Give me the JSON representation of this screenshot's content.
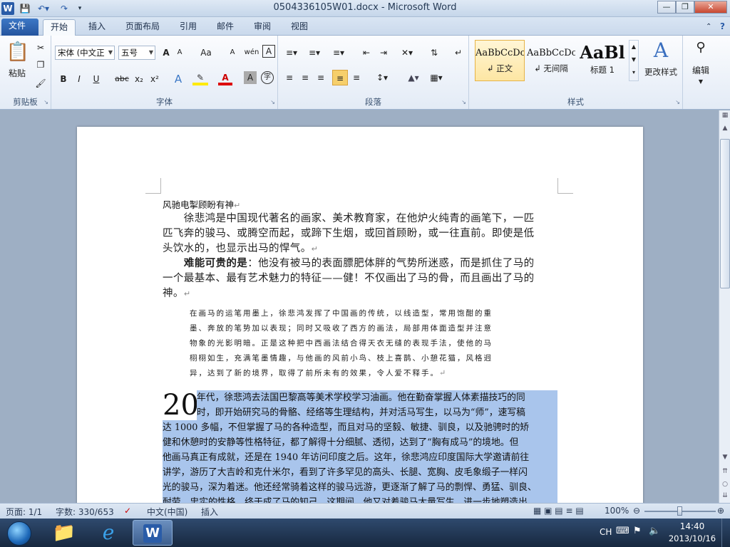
{
  "window": {
    "title": "0504336105W01.docx - Microsoft Word",
    "app_icon": "W",
    "quick_access": [
      "save-icon",
      "undo-icon",
      "redo-icon",
      "customize-icon"
    ]
  },
  "tabs": [
    {
      "label": "文件"
    },
    {
      "label": "开始"
    },
    {
      "label": "插入"
    },
    {
      "label": "页面布局"
    },
    {
      "label": "引用"
    },
    {
      "label": "邮件"
    },
    {
      "label": "审阅"
    },
    {
      "label": "视图"
    }
  ],
  "ribbon": {
    "clipboard": {
      "label": "剪贴板",
      "paste": "粘贴"
    },
    "font": {
      "label": "字体",
      "name": "宋体 (中文正",
      "size": "五号",
      "bold": "B",
      "italic": "I",
      "underline": "U",
      "strike": "abc",
      "sub": "x₂",
      "sup": "x²",
      "grow": "A",
      "shrink": "A",
      "case": "Aa",
      "clear": "A",
      "phonetic": "wén",
      "border_char": "A",
      "color": "A",
      "shade": "A",
      "enclose": "字"
    },
    "paragraph": {
      "label": "段落"
    },
    "styles": {
      "label": "样式",
      "items": [
        {
          "sample": "AaBbCcDc",
          "name": "↲ 正文"
        },
        {
          "sample": "AaBbCcDc",
          "name": "↲ 无间隔"
        },
        {
          "sample": "AaBl",
          "name": "标题 1"
        }
      ],
      "change": "更改样式"
    },
    "editing": {
      "label": "编辑"
    }
  },
  "document": {
    "title_line": "风驰电掣顾盼有神",
    "para1": [
      "　　徐悲鸿是中国现代著名的画家、美术教育家，在他炉火纯青的画笔下，一匹",
      "匹飞奔的骏马、或腾空而起，或蹄下生烟，或回首顾盼，或一往直前。即使是低",
      "头饮水的，也显示出马的悍气。"
    ],
    "para2_bold": "难能可贵的是",
    "para2": [
      "：他没有被马的表面膘肥体胖的气势所迷惑，而是抓住了马的",
      "一个最基本、最有艺术魅力的特征——健！不仅画出了马的骨，而且画出了马的",
      "神。"
    ],
    "para3": [
      "在画马的运笔用墨上，徐悲鸿发挥了中国画的传统，以线造型，常用饱酣的重",
      "墨、奔放的笔势加以表现；同时又吸收了西方的画法，局部用体面造型并注意",
      "物象的光影明暗。正是这种把中西画法结合得天衣无缝的表现手法，使他的马",
      "栩栩如生，充满笔墨情趣，与他画的风前小鸟、枝上喜鹊、小憩花猫，风格迥",
      "异，达到了新的境界，取得了前所未有的效果，令人爱不释手。"
    ],
    "dropcap": "20",
    "para4": [
      "年代，徐悲鸿去法国巴黎高等美术学校学习油画。他在勤奋掌握人体素描技巧的同",
      "时，即开始研究马的骨骼、经络等生理结构，并对活马写生，以马为“师”，速写稿",
      "达 1000 多幅，不但掌握了马的各种造型，而且对马的坚毅、敏捷、驯良，以及驰骋时的矫",
      "健和休憩时的安静等性格特征，都了解得十分细腻、透彻，达到了“胸有成马”的境地。但",
      "他画马真正有成就，还是在 1940 年访问印度之后。这年，徐悲鸿应印度国际大学邀请前往",
      "讲学，游历了大吉岭和克什米尔，看到了许多罕见的高头、长腿、宽胸、皮毛象缎子一样闪",
      "光的骏马，深为着迷。他还经常骑着这样的骏马远游，更逐渐了解了马的剽悍、勇猛、驯良、",
      "耐劳、忠实的性格，终于成了马的知己，这期间，他又对着骏马大量写生，进一步地塑造出"
    ]
  },
  "status": {
    "page": "页面: 1/1",
    "words": "字数: 330/653",
    "lang": "中文(中国)",
    "mode": "插入",
    "zoom": "100%"
  },
  "taskbar": {
    "ime": "CH",
    "time": "14:40",
    "date": "2013/10/16"
  }
}
